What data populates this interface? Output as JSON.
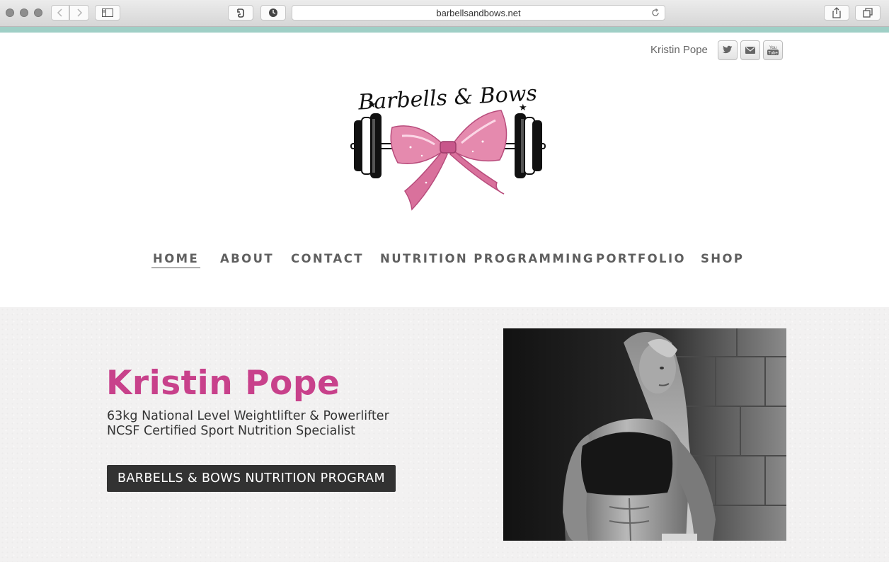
{
  "browser": {
    "url": "barbellsandbows.net"
  },
  "header": {
    "account_name": "Kristin Pope",
    "logo_text": "Barbells & Bows",
    "social": [
      {
        "icon": "twitter-icon"
      },
      {
        "icon": "mail-icon"
      },
      {
        "icon": "youtube-icon",
        "label": "You Tube"
      }
    ]
  },
  "nav": {
    "items": [
      {
        "label": "HOME",
        "active": true
      },
      {
        "label": "ABOUT",
        "active": false
      },
      {
        "label": "CONTACT",
        "active": false
      },
      {
        "label": "NUTRITION PROGRAMMING",
        "active": false
      },
      {
        "label": "PORTFOLIO",
        "active": false
      },
      {
        "label": "SHOP",
        "active": false
      }
    ]
  },
  "hero": {
    "name": "Kristin Pope",
    "line1": "63kg National Level Weightlifter & Powerlifter",
    "line2": "NCSF Certified Sport Nutrition Specialist",
    "cta_label": "BARBELLS & BOWS NUTRITION PROGRAM"
  },
  "colors": {
    "accent_pink": "#c8418b",
    "teal_bar": "#9fcfc6",
    "button_dark": "#323232",
    "hero_bg": "#f2f1f1"
  }
}
